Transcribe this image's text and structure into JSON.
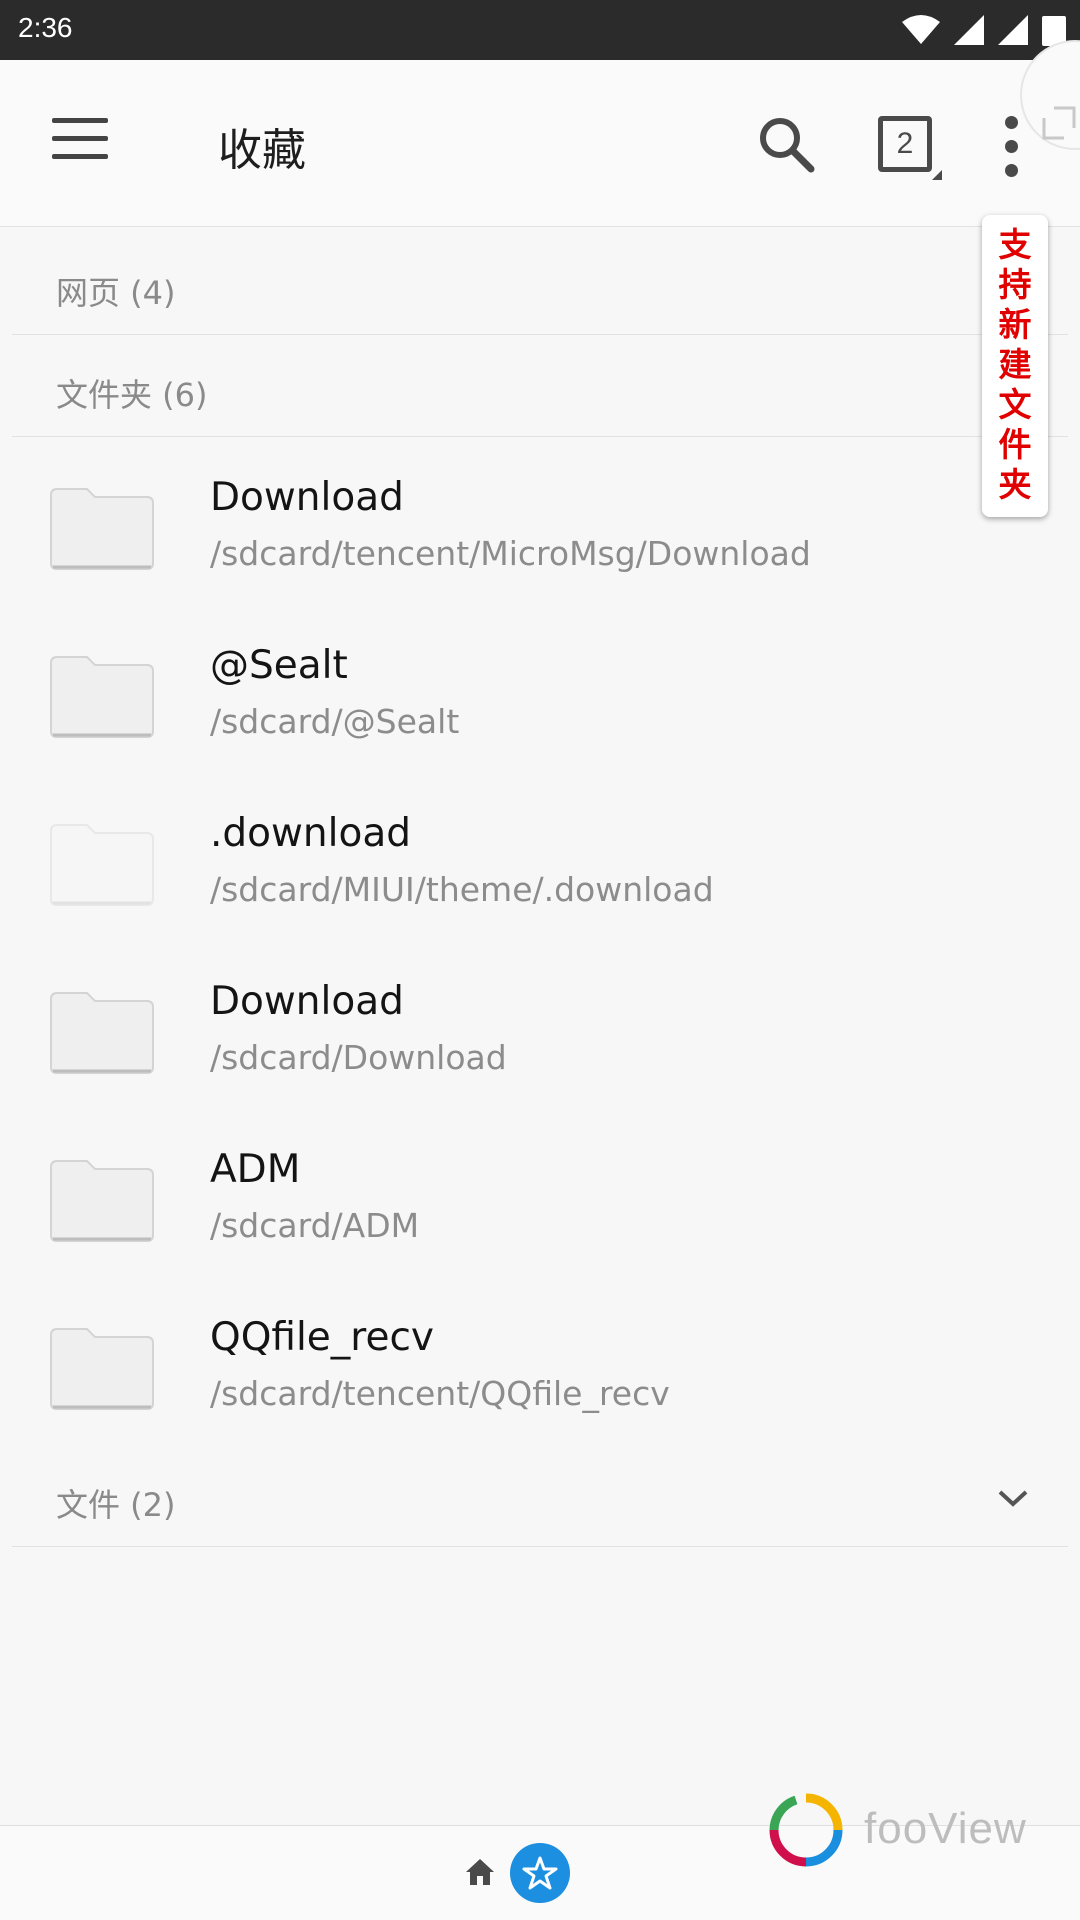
{
  "status_bar": {
    "time": "2:36"
  },
  "app_bar": {
    "title": "收藏",
    "tab_count": "2"
  },
  "sections": {
    "webpages": "网页 (4)",
    "folders": "文件夹 (6)",
    "files": "文件 (2)"
  },
  "folders": [
    {
      "name": "Download",
      "path": "/sdcard/tencent/MicroMsg/Download"
    },
    {
      "name": "@Sealt",
      "path": "/sdcard/@Sealt"
    },
    {
      "name": ".download",
      "path": "/sdcard/MIUI/theme/.download"
    },
    {
      "name": "Download",
      "path": "/sdcard/Download"
    },
    {
      "name": "ADM",
      "path": "/sdcard/ADM"
    },
    {
      "name": "QQfile_recv",
      "path": "/sdcard/tencent/QQfile_recv"
    }
  ],
  "annotation": {
    "chars": [
      "支",
      "持",
      "新",
      "建",
      "文",
      "件",
      "夹"
    ]
  },
  "watermark": {
    "text": "fooView"
  },
  "colors": {
    "accent": "#1c8fe0",
    "annotation": "#e00000",
    "status_bar": "#2b2b2b"
  },
  "icons": [
    "wifi-icon",
    "signal-icon",
    "battery-icon",
    "menu-icon",
    "search-icon",
    "tabs-icon",
    "more-icon",
    "folder-icon",
    "chevron-down-icon",
    "home-icon",
    "star-icon",
    "fooview-logo"
  ]
}
